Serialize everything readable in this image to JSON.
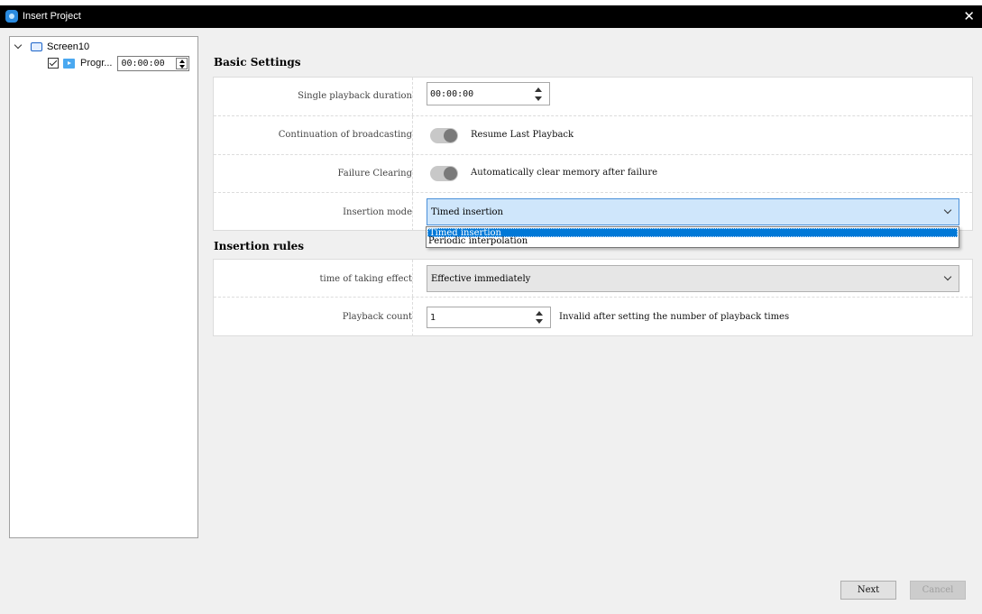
{
  "window": {
    "title": "Insert Project",
    "close_glyph": "✕"
  },
  "tree": {
    "screen_label": "Screen10",
    "program_label": "Progr...",
    "program_time": "00:00:00",
    "program_checked": true
  },
  "basic": {
    "heading": "Basic Settings",
    "duration_label": "Single playback duration",
    "duration_value": "00:00:00",
    "continuation_label": "Continuation of broadcasting",
    "continuation_toggle_text": "Resume Last Playback",
    "failure_label": "Failure Clearing",
    "failure_toggle_text": "Automatically clear memory after failure",
    "mode_label": "Insertion mode",
    "mode_value": "Timed insertion",
    "mode_options": [
      "Timed insertion",
      "Periodic interpolation"
    ]
  },
  "rules": {
    "heading": "Insertion rules",
    "effect_label": "time of taking effect",
    "effect_value": "Effective immediately",
    "count_label": "Playback count",
    "count_value": "1",
    "count_note": "Invalid after setting the number of playback times"
  },
  "buttons": {
    "next": "Next",
    "cancel": "Cancel"
  },
  "colors": {
    "accent": "#0078d7",
    "combo_active": "#cfe6fb"
  }
}
